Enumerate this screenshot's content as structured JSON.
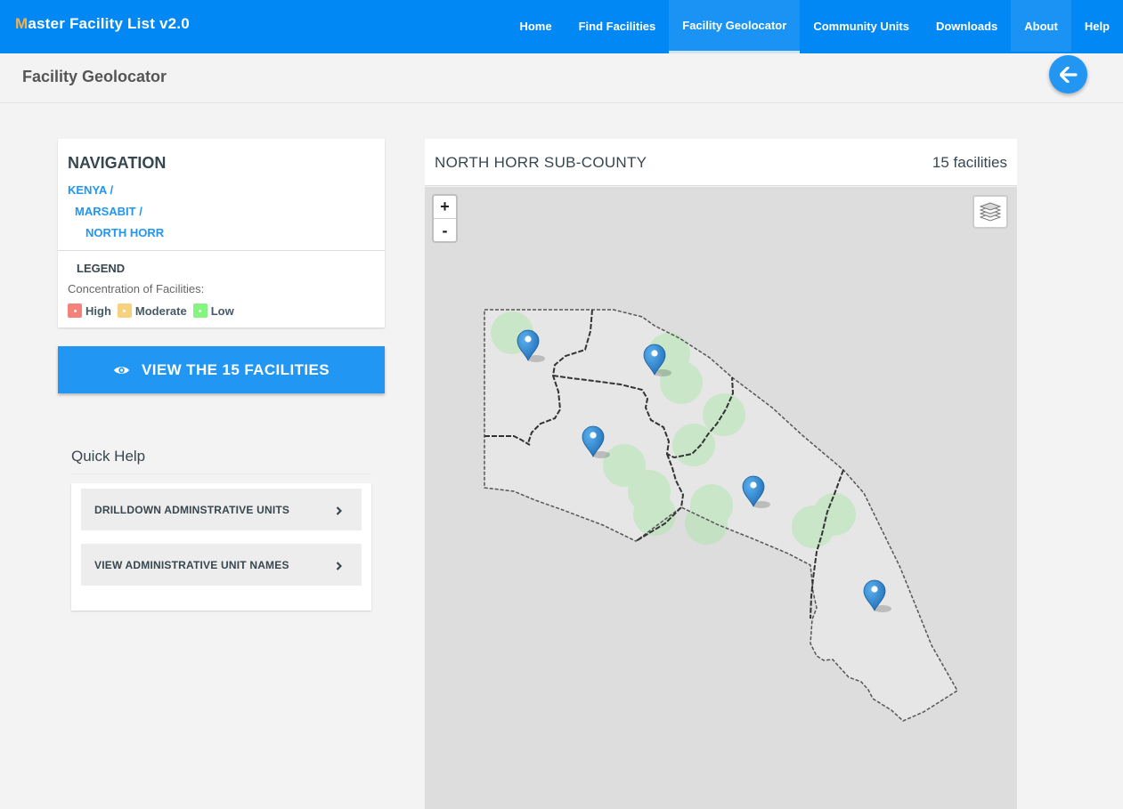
{
  "brand": {
    "first_letter": "M",
    "rest": "aster Facility List v2.0"
  },
  "nav": {
    "home": "Home",
    "find_facilities": "Find Facilities",
    "facility_geolocator": "Facility Geolocator",
    "community_units": "Community Units",
    "downloads": "Downloads",
    "about": "About",
    "help": "Help"
  },
  "page": {
    "title": "Facility Geolocator",
    "back_icon": "arrow-left-icon"
  },
  "navigation": {
    "heading": "NAVIGATION",
    "breadcrumbs": [
      "KENYA /",
      "MARSABIT /",
      "NORTH HORR"
    ]
  },
  "legend": {
    "title": "LEGEND",
    "subtitle": "Concentration of Facilities:",
    "items": [
      {
        "label": "High",
        "color": "#f4827a"
      },
      {
        "label": "Moderate",
        "color": "#f7d27e"
      },
      {
        "label": "Low",
        "color": "#85f57f"
      }
    ]
  },
  "view_button": {
    "label": "VIEW THE 15 FACILITIES",
    "icon": "eye-icon"
  },
  "quick_help": {
    "title": "Quick Help",
    "items": [
      "DRILLDOWN ADMINSTRATIVE UNITS",
      "VIEW ADMINISTRATIVE UNIT NAMES"
    ]
  },
  "map": {
    "title": "NORTH HORR SUB-COUNTY",
    "count": "15 facilities",
    "zoom_in": "+",
    "zoom_out": "-",
    "layers_icon": "layers-icon"
  },
  "colors": {
    "primary": "#0288f4",
    "accent": "#2196f3",
    "brand_letter": "#f4b04a"
  }
}
